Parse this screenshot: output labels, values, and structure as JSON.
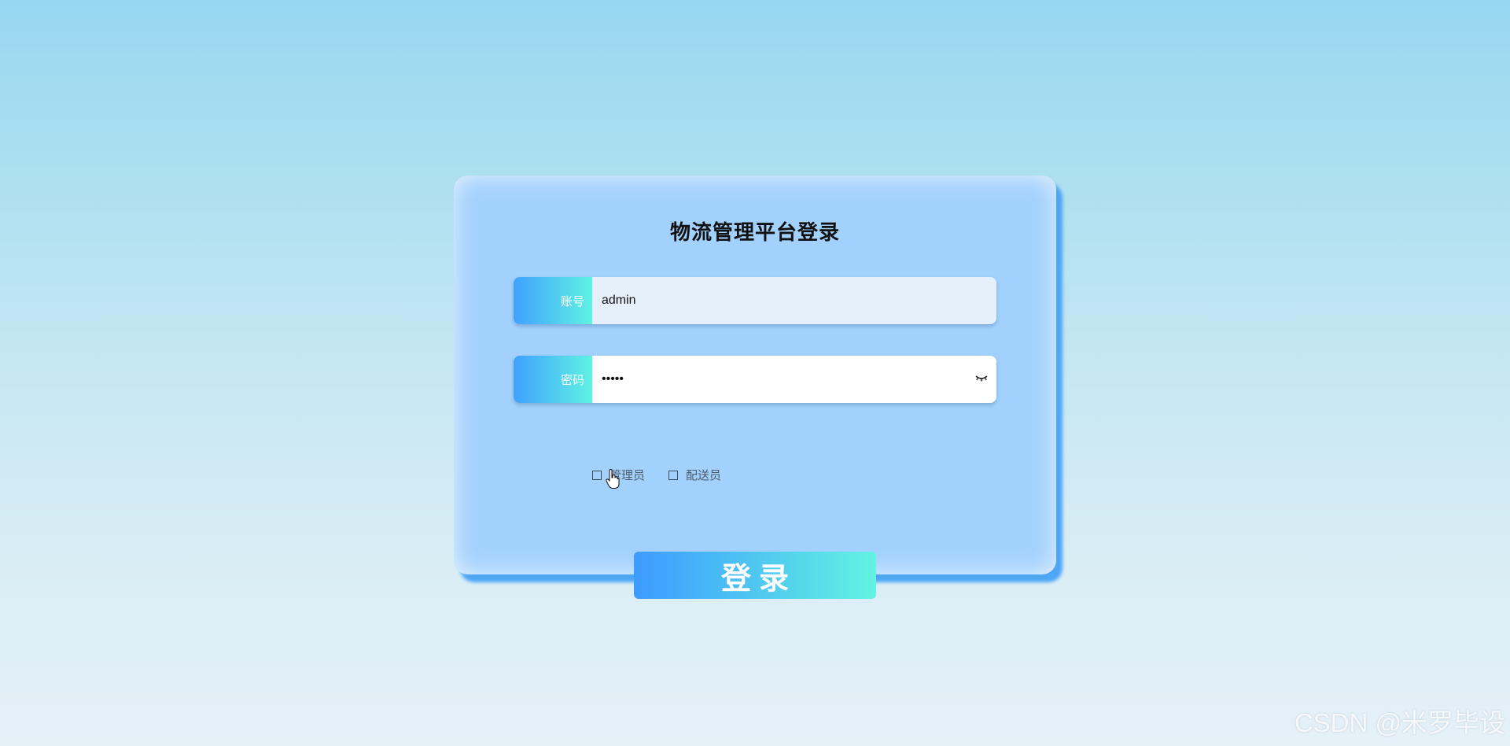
{
  "login": {
    "title": "物流管理平台登录",
    "account": {
      "label": "账号",
      "value": "admin"
    },
    "password": {
      "label": "密码",
      "value": "12345"
    },
    "roles": [
      {
        "label": "管理员",
        "checked": false
      },
      {
        "label": "配送员",
        "checked": false
      }
    ],
    "submit_label": "登录"
  },
  "watermark": "CSDN @米罗毕设",
  "colors": {
    "card": "#a3d1fd",
    "gradient_start": "#3fa1ff",
    "gradient_end": "#60f2e3",
    "card_shadow": "#4ea6f5"
  },
  "icons": [
    "eye-closed-icon",
    "pointer-cursor-icon"
  ]
}
